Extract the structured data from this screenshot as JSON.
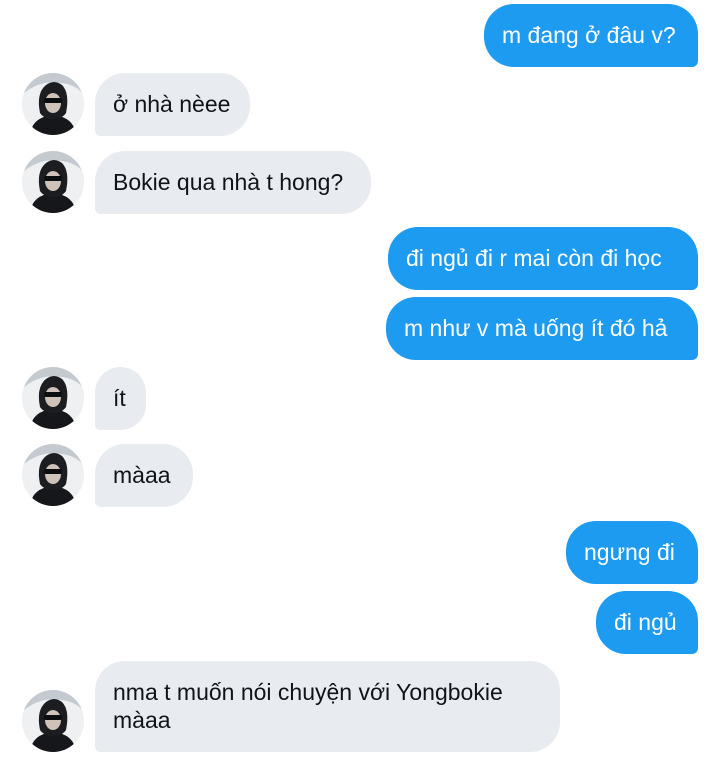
{
  "conversation": {
    "messages": [
      {
        "sender": "me",
        "text": "m đang ở đâu v?"
      },
      {
        "sender": "them",
        "text": "ở nhà nèee"
      },
      {
        "sender": "them",
        "text": "Bokie qua nhà t hong?"
      },
      {
        "sender": "me",
        "text": "đi ngủ đi r mai còn đi học"
      },
      {
        "sender": "me",
        "text": "m như v mà uống ít đó hả"
      },
      {
        "sender": "them",
        "text": "ít"
      },
      {
        "sender": "them",
        "text": "màaa"
      },
      {
        "sender": "me",
        "text": "ngưng đi"
      },
      {
        "sender": "me",
        "text": "đi ngủ"
      },
      {
        "sender": "them",
        "text": "nma t muốn nói chuyện với Yongbokie màaa"
      }
    ]
  },
  "colors": {
    "sent_bubble": "#1d9bf0",
    "received_bubble": "#e8ecf0",
    "background": "#ffffff"
  }
}
